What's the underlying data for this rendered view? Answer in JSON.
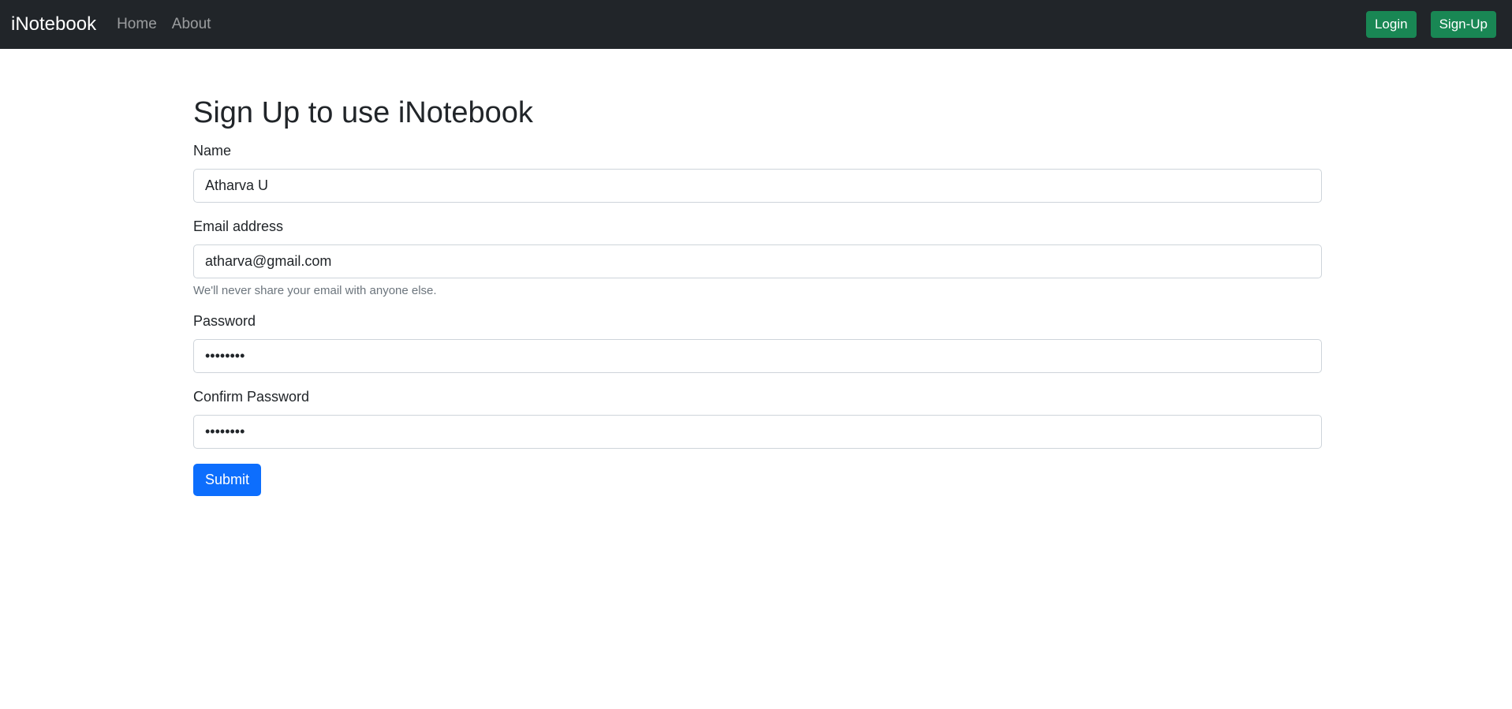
{
  "navbar": {
    "brand": "iNotebook",
    "links": [
      {
        "label": "Home"
      },
      {
        "label": "About"
      }
    ],
    "login_label": "Login",
    "signup_label": "Sign-Up"
  },
  "form": {
    "title": "Sign Up to use iNotebook",
    "name_label": "Name",
    "name_value": "Atharva U",
    "email_label": "Email address",
    "email_value": "atharva@gmail.com",
    "email_help": "We'll never share your email with anyone else.",
    "password_label": "Password",
    "password_value": "password",
    "confirm_label": "Confirm Password",
    "confirm_value": "password",
    "submit_label": "Submit"
  },
  "colors": {
    "navbar_bg": "#212529",
    "success": "#198754",
    "primary": "#0d6efd",
    "muted": "#6c757d"
  }
}
